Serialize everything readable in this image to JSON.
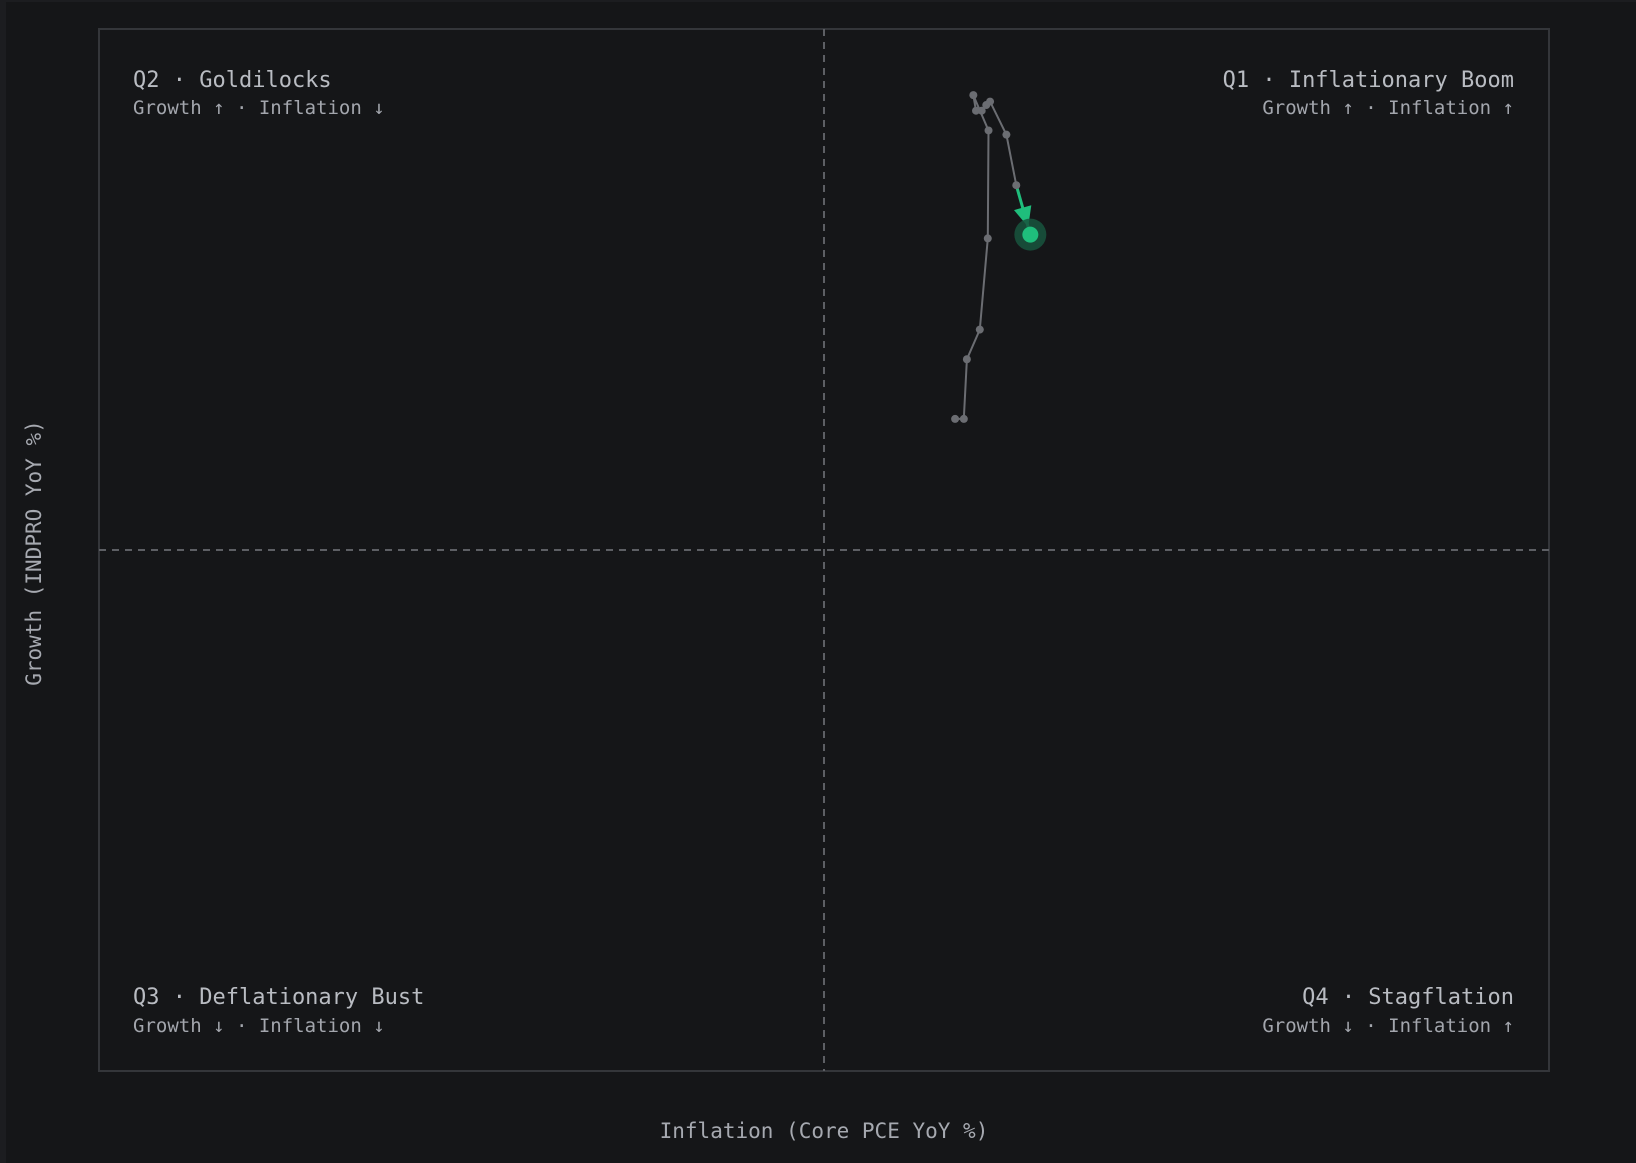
{
  "chart_data": {
    "type": "scatter",
    "xlabel": "Inflation (Core PCE YoY %)",
    "ylabel": "Growth (INDPRO YoY %)",
    "grid": false,
    "quadrants": {
      "q1": {
        "title": "Q1 · Inflationary Boom",
        "subtitle": "Growth ↑ · Inflation ↑"
      },
      "q2": {
        "title": "Q2 · Goldilocks",
        "subtitle": "Growth ↑ · Inflation ↓"
      },
      "q3": {
        "title": "Q3 · Deflationary Bust",
        "subtitle": "Growth ↓ · Inflation ↓"
      },
      "q4": {
        "title": "Q4 · Stagflation",
        "subtitle": "Growth ↓ · Inflation ↑"
      }
    },
    "trail": [
      {
        "x": 0.345,
        "y": 0.345
      },
      {
        "x": 0.368,
        "y": 0.345
      },
      {
        "x": 0.376,
        "y": 0.502
      },
      {
        "x": 0.41,
        "y": 0.58
      },
      {
        "x": 0.431,
        "y": 0.82
      },
      {
        "x": 0.433,
        "y": 1.104
      },
      {
        "x": 0.393,
        "y": 1.197
      },
      {
        "x": 0.4,
        "y": 1.156
      },
      {
        "x": 0.415,
        "y": 1.156
      },
      {
        "x": 0.427,
        "y": 1.171
      },
      {
        "x": 0.437,
        "y": 1.18
      },
      {
        "x": 0.48,
        "y": 1.093
      },
      {
        "x": 0.506,
        "y": 0.96
      },
      {
        "x": 0.543,
        "y": 0.83
      }
    ],
    "current": {
      "x": 0.543,
      "y": 0.83
    },
    "colors": {
      "trail": "#6b6d72",
      "current": "#1fbe7c",
      "current_halo": "#17553e",
      "quadrant_lines": "#5d5f64",
      "plot_border": "#34363a"
    }
  }
}
